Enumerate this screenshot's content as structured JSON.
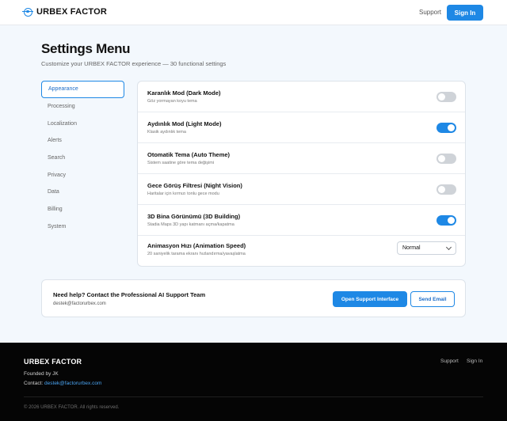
{
  "header": {
    "brand": "URBEX FACTOR",
    "support_label": "Support",
    "signin_label": "Sign In"
  },
  "page": {
    "title": "Settings Menu",
    "subtitle": "Customize your URBEX FACTOR experience — 30 functional settings"
  },
  "sidebar": {
    "items": [
      {
        "label": "Appearance",
        "active": true
      },
      {
        "label": "Processing"
      },
      {
        "label": "Localization"
      },
      {
        "label": "Alerts"
      },
      {
        "label": "Search"
      },
      {
        "label": "Privacy"
      },
      {
        "label": "Data"
      },
      {
        "label": "Billing"
      },
      {
        "label": "System"
      }
    ]
  },
  "settings": [
    {
      "title": "Karanlık Mod (Dark Mode)",
      "desc": "Göz yormayan koyu tema",
      "type": "toggle",
      "on": false
    },
    {
      "title": "Aydınlık Mod (Light Mode)",
      "desc": "Klasik aydınlık tema",
      "type": "toggle",
      "on": true
    },
    {
      "title": "Otomatik Tema (Auto Theme)",
      "desc": "Sistem saatine göre tema değişimi",
      "type": "toggle",
      "on": false
    },
    {
      "title": "Gece Görüş Filtresi (Night Vision)",
      "desc": "Haritalar için kırmızı tonlu gece modu",
      "type": "toggle",
      "on": false
    },
    {
      "title": "3D Bina Görünümü (3D Building)",
      "desc": "Stadia Maps 3D yapı katmanı açma/kapatma",
      "type": "toggle",
      "on": true
    },
    {
      "title": "Animasyon Hızı (Animation Speed)",
      "desc": "20 saniyelik tarama ekranı hızlandırma/yavaşlatma",
      "type": "select",
      "value": "Normal"
    }
  ],
  "help": {
    "title": "Need help? Contact the Professional AI Support Team",
    "email": "destek@factorurbex.com",
    "support_button": "Open Support Interface",
    "email_button": "Send Email"
  },
  "footer": {
    "brand": "URBEX FACTOR",
    "founded": "Founded by JK",
    "contact_label": "Contact:",
    "contact_email": "destek@factorurbex.com",
    "support_link": "Support",
    "signin_link": "Sign In",
    "copyright": "© 2026 URBEX FACTOR. All rights reserved."
  },
  "colors": {
    "accent": "#1e88e5",
    "page_bg": "#f3f8fd",
    "footer_bg": "#050505"
  }
}
